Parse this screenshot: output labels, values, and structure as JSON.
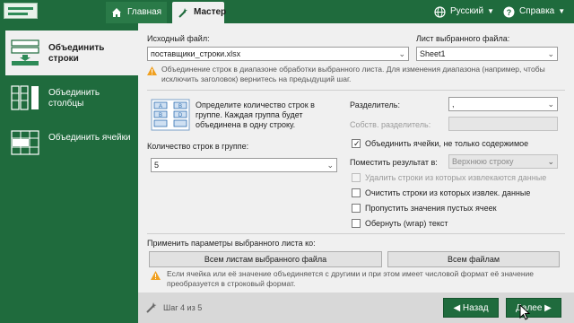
{
  "topbar": {
    "tabs": [
      {
        "label": "Главная",
        "icon": "home-icon"
      },
      {
        "label": "Мастер",
        "icon": "magic-wand-icon"
      }
    ],
    "language": "Русский",
    "help": "Справка"
  },
  "sidebar": {
    "items": [
      {
        "label": "Объединить строки",
        "icon": "merge-rows-icon",
        "active": true
      },
      {
        "label": "Объединить столбцы",
        "icon": "merge-columns-icon",
        "active": false
      },
      {
        "label": "Объединить ячейки",
        "icon": "merge-cells-icon",
        "active": false
      }
    ]
  },
  "form": {
    "source_file_label": "Исходный файл:",
    "source_file_value": "поставщики_строки.xlsx",
    "sheet_label": "Лист выбранного файла:",
    "sheet_value": "Sheet1",
    "range_note": "Объединение строк в диапазоне обработки выбранного листа. Для изменения диапазона (например, чтобы исключить заголовок) вернитесь на предыдущий шаг.",
    "group_hint": "Определите количество строк в группе. Каждая группа будет объединена в одну строку.",
    "group_count_label": "Количество строк в группе:",
    "group_count_value": "5",
    "separator_label": "Разделитель:",
    "separator_value": ",",
    "custom_separator_label": "Собств. разделитель:",
    "place_result_label": "Поместить результат в:",
    "place_result_value": "Верхнюю строку",
    "checkboxes": [
      {
        "label": "Объединить ячейки, не только содержимое",
        "checked": true,
        "disabled": false
      },
      {
        "label": "Удалить строки из которых извлекаются данные",
        "checked": false,
        "disabled": true
      },
      {
        "label": "Очистить строки из которых извлек. данные",
        "checked": false,
        "disabled": false
      },
      {
        "label": "Пропустить значения пустых ячеек",
        "checked": false,
        "disabled": false
      },
      {
        "label": "Обернуть (wrap) текст",
        "checked": false,
        "disabled": false
      }
    ],
    "apply_label": "Применить параметры выбранного листа ко:",
    "apply_all_sheets": "Всем листам выбранного файла",
    "apply_all_files": "Всем файлам",
    "bottom_note": "Если ячейка или её значение объединяется с другими и при этом имеет числовой формат её значение преобразуется в строковый формат."
  },
  "footer": {
    "step": "Шаг 4 из 5",
    "back": "Назад",
    "next": "Далее"
  },
  "colors": {
    "accent": "#1f6b3d",
    "panel": "#f0f0f0",
    "warning": "#f0a020"
  }
}
